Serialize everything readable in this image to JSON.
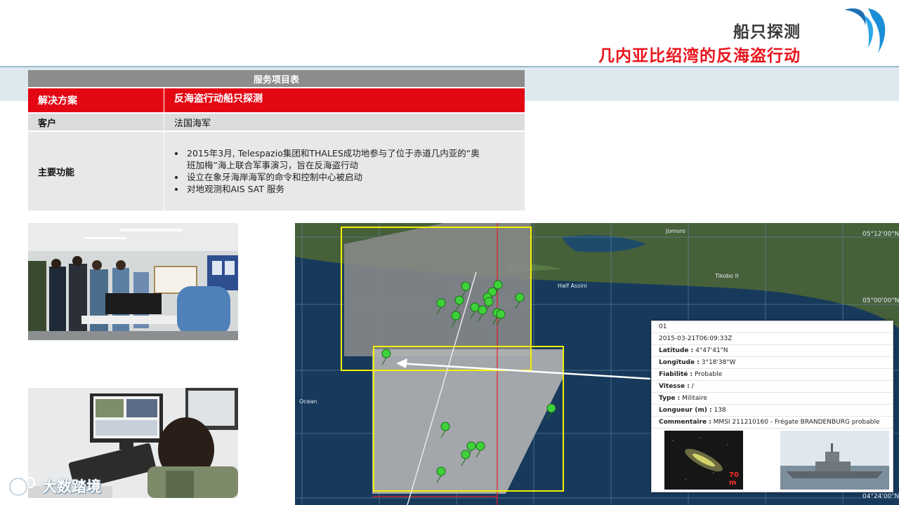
{
  "header": {
    "title": "船只探测",
    "subtitle": "几内亚比绍湾的反海盗行动"
  },
  "table": {
    "heading": "服务项目表",
    "rows": [
      {
        "label": "解决方案",
        "value": "反海盗行动船只探测"
      },
      {
        "label": "客户",
        "value": "法国海军"
      },
      {
        "label": "主要功能",
        "bullets": [
          "2015年3月, Telespazio集团和THALES成功地参与了位于赤道几内亚的“奥",
          "班加梅”海上联合军事演习，旨在反海盗行动",
          "设立在象牙海岸海军的命令和控制中心被启动",
          "对地观测和AIS SAT 服务"
        ]
      }
    ]
  },
  "map": {
    "labels": {
      "lat1": "05°12'00\"N",
      "lat2": "05°00'00\"N",
      "lat3": "04°24'00\"N",
      "place1": "Jomoro",
      "place2": "Half Assini",
      "place3": "Tikobo II",
      "ocean": "Ocean"
    }
  },
  "info_panel": {
    "id": "01",
    "timestamp": "2015-03-21T06:09:33Z",
    "latitude_label": "Latitude :",
    "latitude": "4°47'41\"N",
    "longitude_label": "Longitude :",
    "longitude": "3°18'38\"W",
    "reliability_label": "Fiabilité :",
    "reliability": "Probable",
    "speed_label": "Vitesse :",
    "speed": "/",
    "type_label": "Type :",
    "type": "Militaire",
    "length_label": "Longueur (m) :",
    "length": "138",
    "comment_label": "Commentaire :",
    "comment": "MMSI 211210160 - Frégate BRANDENBURG probable",
    "scale": "70 m"
  },
  "watermark": {
    "text": "大数踏境"
  },
  "colors": {
    "accent_red": "#e30613",
    "title_red": "#e8141c",
    "header_gray": "#8c8c8c",
    "marker_green": "#3ed13a",
    "box_yellow": "#f2f200"
  }
}
